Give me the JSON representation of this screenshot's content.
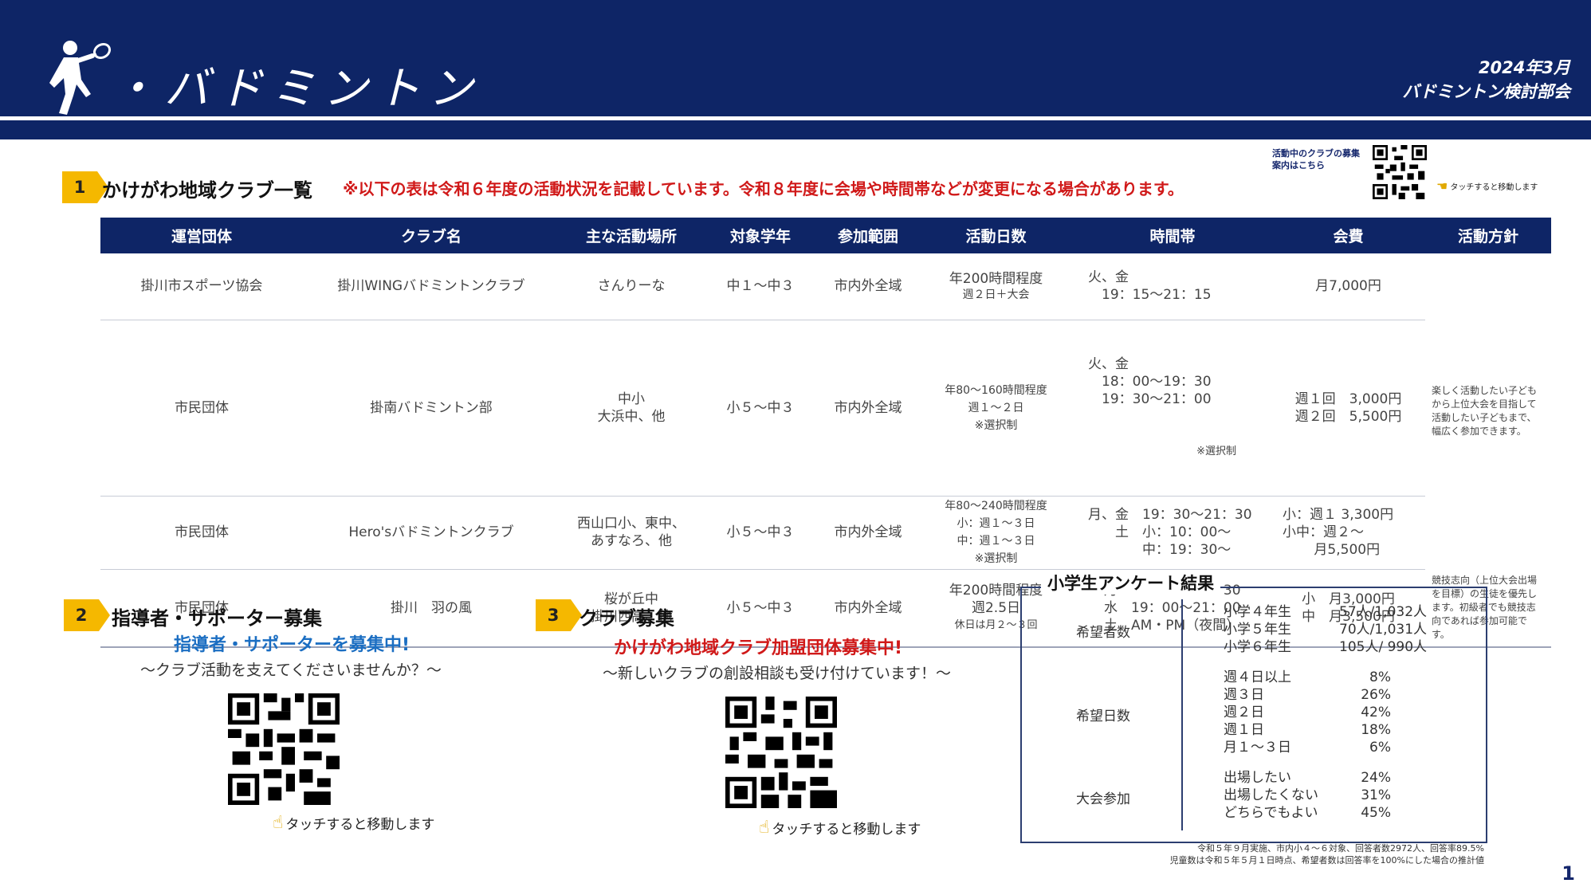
{
  "header": {
    "title": "・バドミントン",
    "date": "2024年3月",
    "org": "バドミントン検討部会",
    "colors": {
      "header_bg": "#0e2566",
      "accent": "#f5b800",
      "notice": "#d01919"
    }
  },
  "section1": {
    "num": "1",
    "title": "かけがわ地域クラブ一覧",
    "notice": "※以下の表は令和６年度の活動状況を記載しています。令和８年度に会場や時間帯などが変更になる場合があります。",
    "qr_label": "活動中のクラブの募集案内はこちら",
    "touch": "タッチすると移動します"
  },
  "table": {
    "headers": [
      "運営団体",
      "クラブ名",
      "主な活動場所",
      "対象学年",
      "参加範囲",
      "活動日数",
      "時間帯",
      "会費",
      "活動方針"
    ],
    "rows": [
      {
        "org": "掛川市スポーツ協会",
        "club": "掛川WINGバドミントンクラブ",
        "place": [
          "さんりーな"
        ],
        "grade": "中１～中３",
        "range": "市内外全域",
        "days": [
          "年200時間程度",
          "週２日＋大会"
        ],
        "time": [
          "火、金",
          "　19：15～21：15"
        ],
        "fee": [
          "月7,000円"
        ]
      },
      {
        "org": "市民団体",
        "club": "掛南バドミントン部",
        "place": [
          "中小",
          "大浜中、他"
        ],
        "grade": "小５～中３",
        "range": "市内外全域",
        "days": [
          "年80～160時間程度",
          "週１～２日",
          "※選択制"
        ],
        "time": [
          "火、金",
          "　18：00～19：30",
          "　19：30～21：00",
          "※選択制"
        ],
        "fee": [
          "週１回　3,000円",
          "週２回　5,500円"
        ]
      },
      {
        "org": "市民団体",
        "club": "Hero'sバドミントンクラブ",
        "place": [
          "西山口小、東中、",
          "あすなろ、他"
        ],
        "grade": "小５～中３",
        "range": "市内外全域",
        "days": [
          "年80～240時間程度",
          "小：週１～３日",
          "中：週１～３日",
          "※選択制"
        ],
        "time": [
          "月、金　19：30～21：30",
          "　　土　小：10：00～",
          "　　　　中：19：30～"
        ],
        "fee": [
          "小：週１ 3,300円",
          "小中：週２～",
          "　　 月5,500円"
        ]
      },
      {
        "org": "市民団体",
        "club": "掛川　羽の風",
        "place": [
          "桜が丘中",
          "掛川西高、他"
        ],
        "grade": "小５～中３",
        "range": "市内外全域",
        "days": [
          "年200時間程度",
          "週2.5日",
          "休日は月２～３回"
        ],
        "time": [
          "月　19：20～21：30",
          "水　19：00～21：00",
          "土　AM・PM（夜間）"
        ],
        "fee": [
          "小　月3,000円",
          "中　月3,500円"
        ]
      }
    ],
    "policy_1": "楽しく活動したい子どもから上位大会を目指して活動したい子どもまで、幅広く参加できます。",
    "policy_2": "競技志向（上位大会出場を目標）の生徒を優先します。初級者でも競技志向であれば参加可能です。"
  },
  "section2": {
    "num": "2",
    "title": "指導者・サポーター募集",
    "headline": "指導者・サポーターを募集中!",
    "sub": "～クラブ活動を支えてくださいませんか？～",
    "touch": "タッチすると移動します"
  },
  "section3": {
    "num": "3",
    "title": "クラブ募集",
    "headline": "かけがわ地域クラブ加盟団体募集中!",
    "sub": "～新しいクラブの創設相談も受け付けています！～",
    "touch": "タッチすると移動します"
  },
  "survey": {
    "title": "小学生アンケート結果",
    "g1": {
      "label": "希望者数",
      "rows": [
        {
          "k": "小学４年生",
          "v": "57人/1,032人"
        },
        {
          "k": "小学５年生",
          "v": "70人/1,031人"
        },
        {
          "k": "小学６年生",
          "v": "105人/ 990人"
        }
      ]
    },
    "g2": {
      "label": "希望日数",
      "rows": [
        {
          "k": "週４日以上",
          "v": "8%"
        },
        {
          "k": "週３日",
          "v": "26%"
        },
        {
          "k": "週２日",
          "v": "42%"
        },
        {
          "k": "週１日",
          "v": "18%"
        },
        {
          "k": "月１～３日",
          "v": "6%"
        }
      ]
    },
    "g3": {
      "label": "大会参加",
      "rows": [
        {
          "k": "出場したい",
          "v": "24%"
        },
        {
          "k": "出場したくない",
          "v": "31%"
        },
        {
          "k": "どちらでもよい",
          "v": "45%"
        }
      ]
    },
    "note1": "令和５年９月実施、市内小４～６対象、回答者数2972人、回答率89.5%",
    "note2": "児童数は令和５年５月１日時点、希望者数は回答率を100%にした場合の推計値"
  },
  "page_number": "1"
}
